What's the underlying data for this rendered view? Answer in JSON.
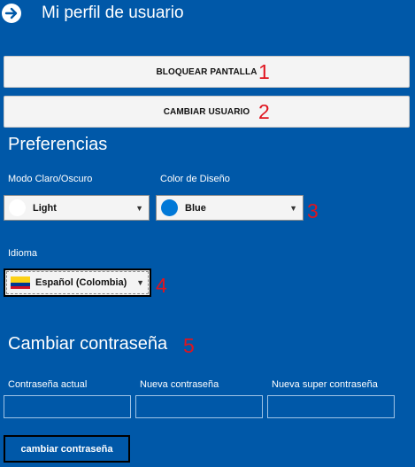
{
  "header": {
    "title": "Mi perfil de usuario",
    "back_icon": "arrow-right-circle-icon"
  },
  "actions": {
    "lock_label": "BLOQUEAR PANTALLA",
    "lock_annotation": "1",
    "switch_label": "CAMBIAR USUARIO",
    "switch_annotation": "2"
  },
  "preferences": {
    "title": "Preferencias",
    "theme_label": "Modo Claro/Oscuro",
    "theme_value": "Light",
    "theme_color": "#ffffff",
    "design_color_label": "Color de Diseño",
    "design_color_value": "Blue",
    "design_color_swatch": "#0078d7",
    "color_annotation": "3",
    "language_label": "Idioma",
    "language_value": "Español (Colombia)",
    "language_annotation": "4"
  },
  "password": {
    "title": "Cambiar contraseña",
    "title_annotation": "5",
    "current_label": "Contraseña actual",
    "current_value": "",
    "new_label": "Nueva contraseña",
    "new_value": "",
    "super_label": "Nueva super contraseña",
    "super_value": "",
    "submit_label": "cambiar contraseña"
  },
  "colors": {
    "background": "#0058a8",
    "annotation": "#e0141e"
  }
}
